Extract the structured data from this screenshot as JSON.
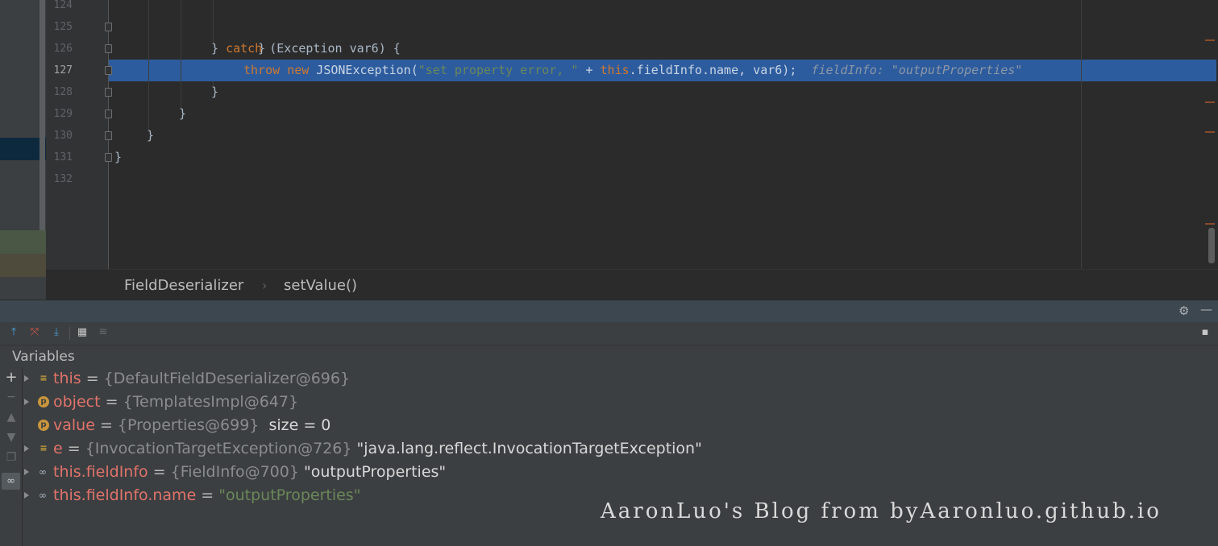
{
  "editor": {
    "line_numbers": [
      "124",
      "125",
      "126",
      "127",
      "128",
      "129",
      "130",
      "131",
      "132"
    ],
    "current_line": "127",
    "lines": {
      "l125_brace": "}",
      "l126_close": "} ",
      "l126_catch": "catch",
      "l126_rest": " (Exception var6) {",
      "l127_throw": "throw",
      "l127_new": "new",
      "l127_ctor": " JSONException(",
      "l127_str": "\"set property error, \"",
      "l127_plus": " + ",
      "l127_this": "this",
      "l127_rest": ".fieldInfo.name, var6);",
      "l127_hint": "fieldInfo: \"outputProperties\"",
      "l128_brace": "}",
      "l129_brace": "}",
      "l130_brace": "}",
      "l131_brace": "}"
    }
  },
  "breadcrumb": {
    "class_name": "FieldDeserializer",
    "separator": "›",
    "method_name": "setValue()"
  },
  "debug": {
    "section_title": "Variables",
    "variables": [
      {
        "name": "this",
        "eq": " = ",
        "type": "{DefaultFieldDeserializer@696}",
        "value": "",
        "icon": "field-icon",
        "expandable": true
      },
      {
        "name": "object",
        "eq": " = ",
        "type": "{TemplatesImpl@647}",
        "value": "",
        "icon": "parameter-icon",
        "expandable": true
      },
      {
        "name": "value",
        "eq": " = ",
        "type": "{Properties@699}",
        "value": "  size = 0",
        "icon": "parameter-icon",
        "expandable": false
      },
      {
        "name": "e",
        "eq": " = ",
        "type": "{InvocationTargetException@726}",
        "value": " \"java.lang.reflect.InvocationTargetException\"",
        "icon": "field-icon",
        "expandable": true
      },
      {
        "name": "this.fieldInfo",
        "eq": " = ",
        "type": "{FieldInfo@700}",
        "value": " \"outputProperties\"",
        "icon": "watch-icon",
        "expandable": true
      },
      {
        "name": "this.fieldInfo.name",
        "eq": " = ",
        "type": "",
        "value": "\"outputProperties\"",
        "icon": "watch-icon",
        "expandable": true,
        "string_value": true
      }
    ]
  },
  "watermark": "AaronLuo's Blog from byAaronluo.github.io",
  "colors": {
    "keyword": "#cc7832",
    "string": "#6a8759",
    "highlight": "#2d5c9e",
    "variable_name": "#e0736b"
  }
}
